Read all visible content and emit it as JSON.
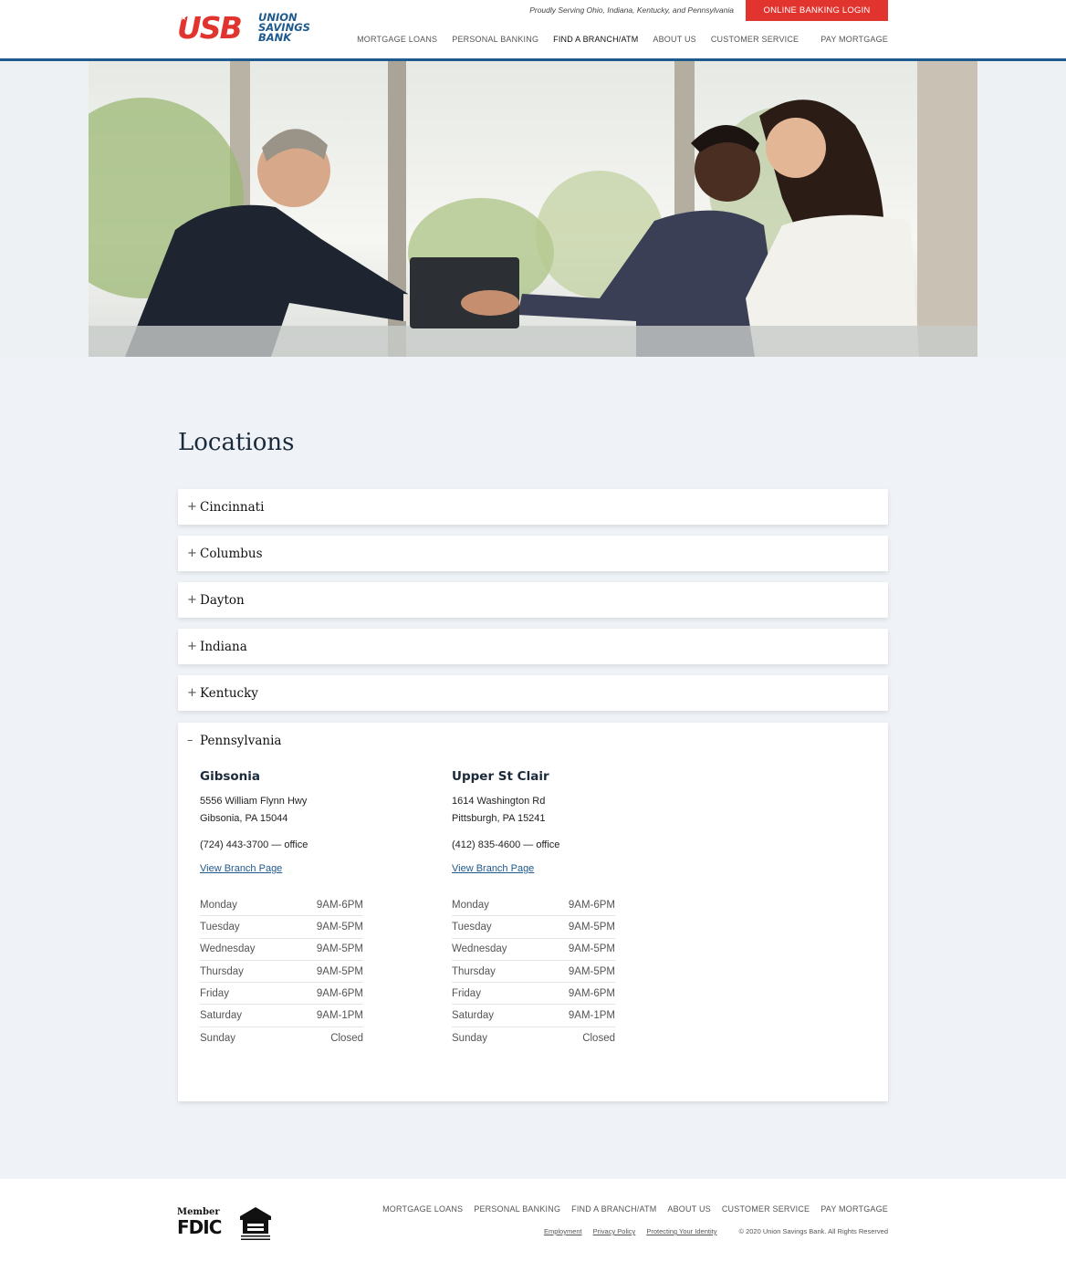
{
  "header": {
    "logo_text_usb": "USB",
    "logo_line1": "UNION",
    "logo_line2": "SAVINGS",
    "logo_line3": "BANK",
    "tagline": "Proudly Serving Ohio, Indiana, Kentucky, and Pennsylvania",
    "login_label": "ONLINE BANKING LOGIN",
    "nav": [
      {
        "label": "MORTGAGE LOANS"
      },
      {
        "label": "PERSONAL BANKING"
      },
      {
        "label": "FIND A BRANCH/ATM"
      },
      {
        "label": "ABOUT US"
      },
      {
        "label": "CUSTOMER SERVICE"
      },
      {
        "label": "PAY MORTGAGE"
      }
    ],
    "accent_color": "#1f5a8e",
    "brand_red": "#e2342f"
  },
  "main": {
    "title": "Locations",
    "accordion": [
      {
        "sign": "+",
        "label": "Cincinnati"
      },
      {
        "sign": "+",
        "label": "Columbus"
      },
      {
        "sign": "+",
        "label": "Dayton"
      },
      {
        "sign": "+",
        "label": "Indiana"
      },
      {
        "sign": "+",
        "label": "Kentucky"
      },
      {
        "sign": "–",
        "label": "Pennsylvania"
      }
    ],
    "branches": [
      {
        "name": "Gibsonia",
        "address1": "5556 William Flynn Hwy",
        "address2": "Gibsonia, PA 15044",
        "phone": "(724) 443-3700 — office",
        "link": "View Branch Page",
        "hours": [
          {
            "day": "Monday",
            "time": "9AM-6PM"
          },
          {
            "day": "Tuesday",
            "time": "9AM-5PM"
          },
          {
            "day": "Wednesday",
            "time": "9AM-5PM"
          },
          {
            "day": "Thursday",
            "time": "9AM-5PM"
          },
          {
            "day": "Friday",
            "time": "9AM-6PM"
          },
          {
            "day": "Saturday",
            "time": "9AM-1PM"
          },
          {
            "day": "Sunday",
            "time": "Closed"
          }
        ]
      },
      {
        "name": "Upper St Clair",
        "address1": "1614 Washington Rd",
        "address2": "Pittsburgh, PA 15241",
        "phone": "(412) 835-4600 — office",
        "link": "View Branch Page",
        "hours": [
          {
            "day": "Monday",
            "time": "9AM-6PM"
          },
          {
            "day": "Tuesday",
            "time": "9AM-5PM"
          },
          {
            "day": "Wednesday",
            "time": "9AM-5PM"
          },
          {
            "day": "Thursday",
            "time": "9AM-5PM"
          },
          {
            "day": "Friday",
            "time": "9AM-6PM"
          },
          {
            "day": "Saturday",
            "time": "9AM-1PM"
          },
          {
            "day": "Sunday",
            "time": "Closed"
          }
        ]
      }
    ]
  },
  "footer": {
    "fdic_member": "Member",
    "fdic_text": "FDIC",
    "nav": [
      {
        "label": "MORTGAGE LOANS"
      },
      {
        "label": "PERSONAL BANKING"
      },
      {
        "label": "FIND A BRANCH/ATM"
      },
      {
        "label": "ABOUT US"
      },
      {
        "label": "CUSTOMER SERVICE"
      },
      {
        "label": "PAY MORTGAGE"
      }
    ],
    "links": [
      {
        "label": "Employment"
      },
      {
        "label": "Privacy Policy"
      },
      {
        "label": "Protecting Your Identity"
      }
    ],
    "copyright": "© 2020 Union Savings Bank. All Rights Reserved"
  }
}
